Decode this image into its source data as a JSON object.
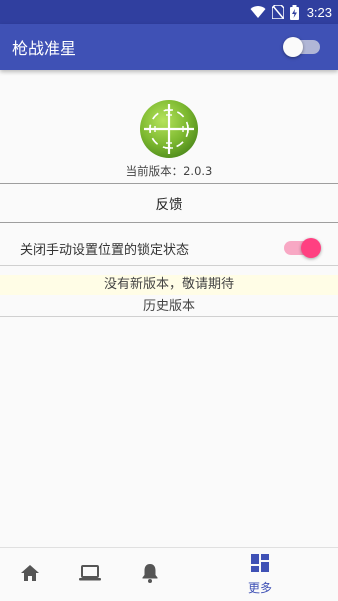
{
  "status_bar": {
    "time": "3:23",
    "icons": [
      "wifi-icon",
      "no-sim-icon",
      "battery-charging-icon"
    ]
  },
  "app_bar": {
    "title": "枪战准星",
    "toggle_state": "off"
  },
  "about": {
    "logo_icon": "crosshair-icon",
    "version_text": "当前版本：2.0.3"
  },
  "feedback": {
    "label": "反馈"
  },
  "lock_setting": {
    "label": "关闭手动设置位置的锁定状态",
    "toggle_state": "on"
  },
  "update_notice": "没有新版本，敬请期待",
  "history_label": "历史版本",
  "bottom_nav": {
    "items": [
      {
        "icon": "home-icon",
        "label": ""
      },
      {
        "icon": "laptop-icon",
        "label": ""
      },
      {
        "icon": "bell-icon",
        "label": ""
      },
      {
        "icon": "dashboard-icon",
        "label": "更多",
        "active": true
      }
    ]
  },
  "colors": {
    "primary": "#3f51b5",
    "primary_dark": "#303f9f",
    "accent": "#ff4081",
    "logo_green": "#8bc34a"
  }
}
